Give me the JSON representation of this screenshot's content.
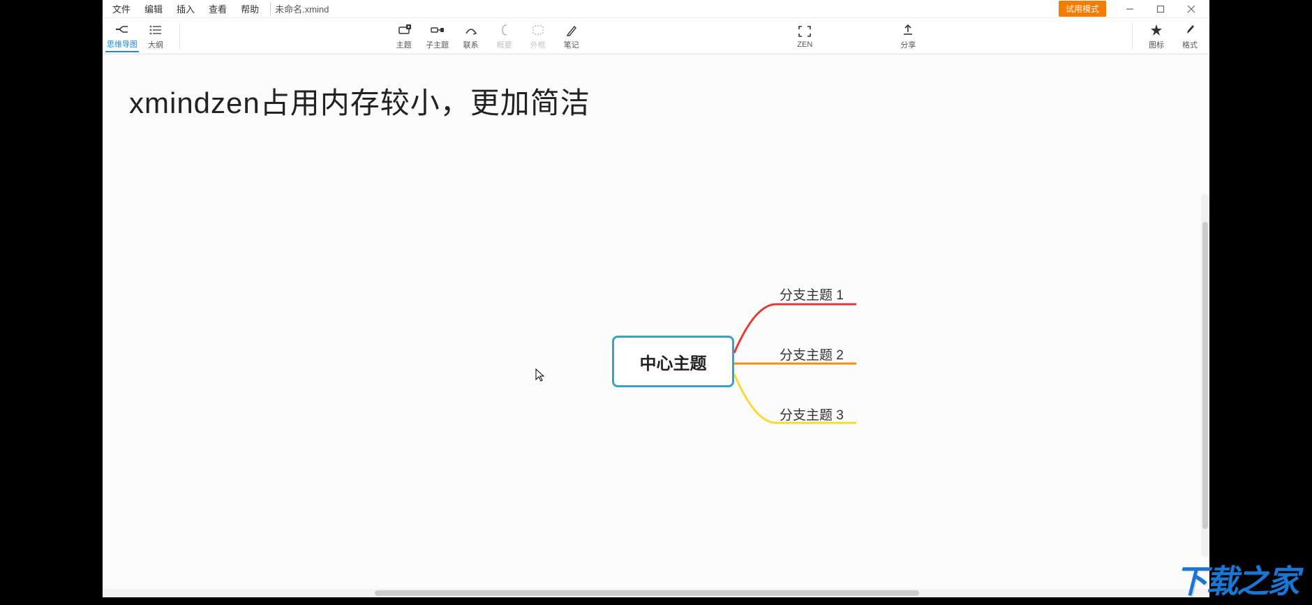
{
  "menus": {
    "file": "文件",
    "edit": "编辑",
    "insert": "插入",
    "view": "查看",
    "help": "帮助"
  },
  "doc_title": "未命名.xmind",
  "trial_badge": "试用模式",
  "toolbar": {
    "mindmap": "思维导图",
    "outline": "大纲",
    "topic": "主题",
    "subtopic": "子主题",
    "relation": "联系",
    "summary": "概要",
    "boundary": "外框",
    "note": "笔记",
    "zen": "ZEN",
    "share": "分享",
    "icons": "图标",
    "format": "格式"
  },
  "headline": "xmindzen占用内存较小，更加简洁",
  "mindmap": {
    "center": "中心主题",
    "branches": [
      "分支主题 1",
      "分支主题 2",
      "分支主题 3"
    ]
  },
  "colors": {
    "branch1": "#e53935",
    "branch2": "#fb8c00",
    "branch3": "#fdd835",
    "center_border": "#36a2c9"
  },
  "watermark": "下载之家"
}
